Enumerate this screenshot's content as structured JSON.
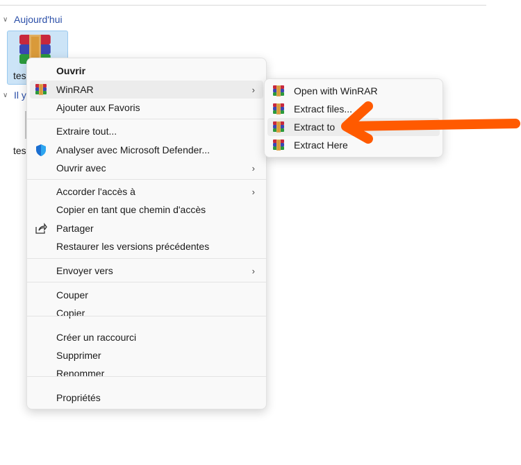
{
  "explorer": {
    "groups": [
      "Aujourd'hui",
      "Il y"
    ],
    "files": [
      "tes",
      "tes"
    ]
  },
  "menu": {
    "items": [
      {
        "label": "Ouvrir",
        "bold": true
      },
      {
        "label": "WinRAR",
        "icon": "winrar-icon",
        "submenu": true
      },
      {
        "label": "Ajouter aux Favoris"
      },
      {
        "label": "Extraire tout..."
      },
      {
        "label": "Analyser avec Microsoft Defender...",
        "icon": "defender-shield-icon"
      },
      {
        "label": "Ouvrir avec",
        "submenu": true
      },
      {
        "label": "Accorder l'accès à",
        "submenu": true
      },
      {
        "label": "Copier en tant que chemin d'accès"
      },
      {
        "label": "Partager",
        "icon": "share-icon"
      },
      {
        "label": "Restaurer les versions précédentes"
      },
      {
        "label": "Envoyer vers",
        "submenu": true
      },
      {
        "label": "Couper"
      },
      {
        "label": "Copier"
      },
      {
        "label": "Créer un raccourci"
      },
      {
        "label": "Supprimer"
      },
      {
        "label": "Renommer"
      },
      {
        "label": "Propriétés"
      }
    ]
  },
  "submenu": {
    "items": [
      "Open with WinRAR",
      "Extract files...",
      "Extract to",
      "Extract Here"
    ]
  },
  "colors": {
    "accent_arrow": "#ff5a00",
    "link": "#2b4fa8",
    "highlight": "#ececec"
  }
}
